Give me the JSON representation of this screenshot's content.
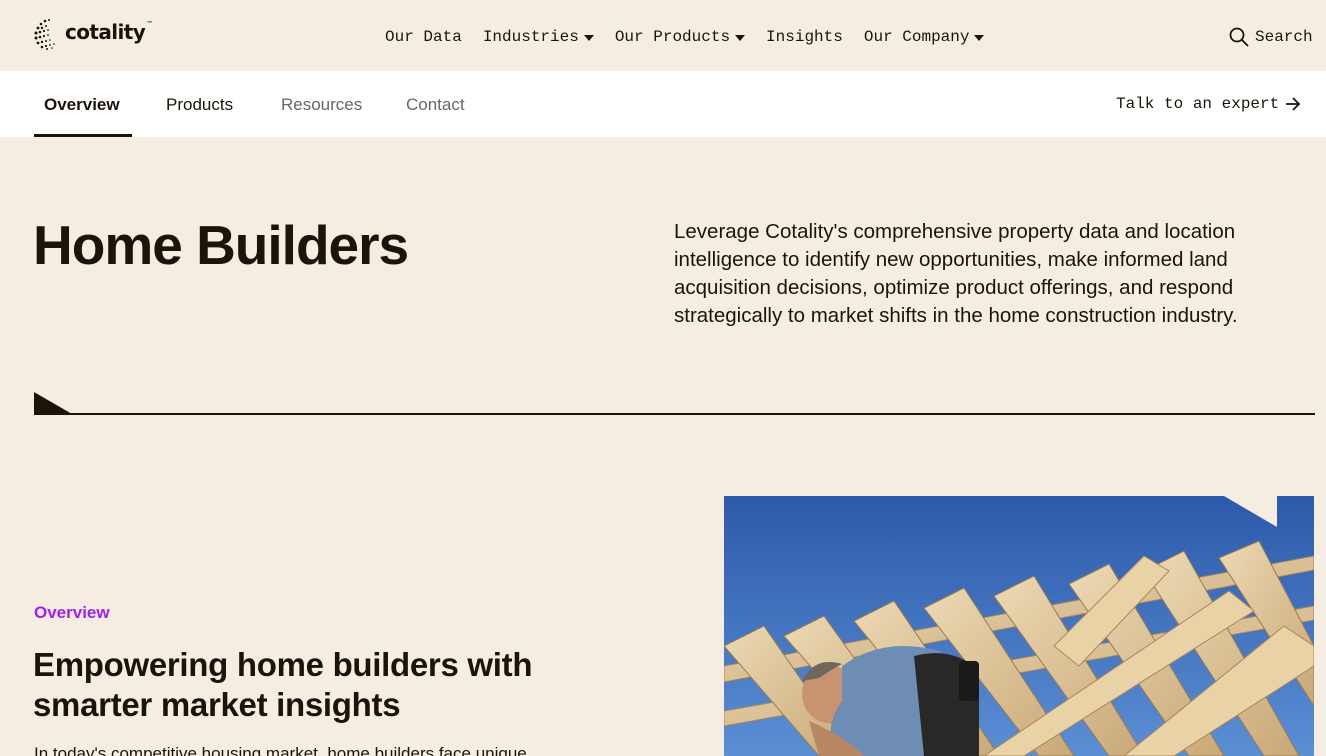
{
  "brand": {
    "name": "cotality",
    "tm": "™"
  },
  "nav": {
    "items": [
      {
        "label": "Our Data",
        "dropdown": false
      },
      {
        "label": "Industries",
        "dropdown": true
      },
      {
        "label": "Our Products",
        "dropdown": true
      },
      {
        "label": "Insights",
        "dropdown": false
      },
      {
        "label": "Our Company",
        "dropdown": true
      }
    ],
    "search_label": "Search"
  },
  "subnav": {
    "tabs": [
      {
        "label": "Overview",
        "state": "active"
      },
      {
        "label": "Products",
        "state": "normal"
      },
      {
        "label": "Resources",
        "state": "muted"
      },
      {
        "label": "Contact",
        "state": "muted"
      }
    ],
    "cta_label": "Talk to an expert"
  },
  "hero": {
    "title": "Home Builders",
    "description": "Leverage Cotality's comprehensive property data and location intelligence to identify new opportunities, make informed land acquisition decisions, optimize product offerings, and respond strategically to market shifts in the home construction industry."
  },
  "overview": {
    "eyebrow": "Overview",
    "title": "Empowering home builders with smarter market insights",
    "body": "In today's competitive housing market, home builders face unique"
  },
  "colors": {
    "background": "#f6ede2",
    "ink": "#1c1409",
    "accent_purple": "#a020f0",
    "subnav_bg": "#ffffff",
    "sky": "#2f5fae"
  },
  "icons": {
    "search": "search-icon",
    "arrow": "arrow-right-icon",
    "caret": "chevron-down-icon"
  }
}
